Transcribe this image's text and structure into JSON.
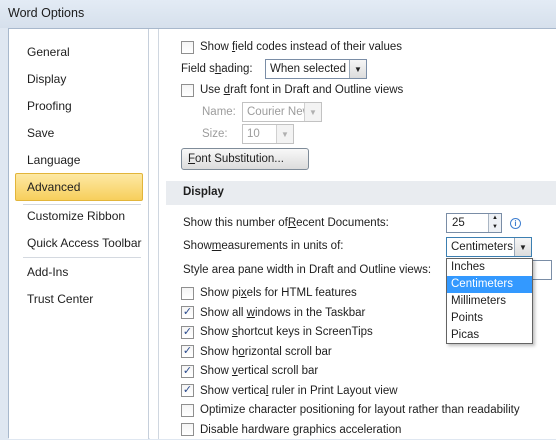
{
  "window": {
    "title": "Word Options"
  },
  "sidebar": {
    "items": [
      {
        "label": "General"
      },
      {
        "label": "Display"
      },
      {
        "label": "Proofing"
      },
      {
        "label": "Save"
      },
      {
        "label": "Language"
      },
      {
        "label": "Advanced",
        "active": true
      },
      {
        "label": "Customize Ribbon"
      },
      {
        "label": "Quick Access Toolbar"
      },
      {
        "label": "Add-Ins"
      },
      {
        "label": "Trust Center"
      }
    ]
  },
  "show_doc": {
    "field_codes": {
      "label_pre": "Show ",
      "key": "f",
      "label_post": "ield codes instead of their values",
      "checked": false
    },
    "field_shading": {
      "label_pre": "Field s",
      "key": "h",
      "label_post": "ading:",
      "value": "When selected"
    },
    "draft_font": {
      "label_pre": "Use ",
      "key": "d",
      "label_post": "raft font in Draft and Outline views",
      "checked": false
    },
    "name": {
      "label": "Name:",
      "value": "Courier New"
    },
    "size": {
      "label": "Size:",
      "value": "10"
    },
    "font_sub_button": {
      "key": "F",
      "label_post": "ont Substitution..."
    }
  },
  "display": {
    "header": "Display",
    "recent_docs": {
      "label_pre": "Show this number of ",
      "key": "R",
      "label_post": "ecent Documents:",
      "value": "25"
    },
    "units": {
      "label_pre": "Show ",
      "key": "m",
      "label_post": "easurements in units of:",
      "value": "Centimeters"
    },
    "style_area": {
      "label": "Style area pane width in Draft and Outline views:"
    },
    "units_options": [
      "Inches",
      "Centimeters",
      "Millimeters",
      "Points",
      "Picas"
    ],
    "units_selected": "Centimeters",
    "checkboxes": [
      {
        "pre": "Show pi",
        "key": "x",
        "post": "els for HTML features",
        "checked": false
      },
      {
        "pre": "Show all ",
        "key": "w",
        "post": "indows in the Taskbar",
        "checked": true
      },
      {
        "pre": "Show ",
        "key": "s",
        "post": "hortcut keys in ScreenTips",
        "checked": true
      },
      {
        "pre": "Show h",
        "key": "o",
        "post": "rizontal scroll bar",
        "checked": true
      },
      {
        "pre": "Show ",
        "key": "v",
        "post": "ertical scroll bar",
        "checked": true
      },
      {
        "pre": "Show vertica",
        "key": "l",
        "post": " ruler in Print Layout view",
        "checked": true
      },
      {
        "pre": "Optimize character positioning for layout rather than readability",
        "key": "",
        "post": "",
        "checked": false
      },
      {
        "pre": "Disable hardware ",
        "key": "g",
        "post": "raphics acceleration",
        "checked": false
      }
    ]
  },
  "colors": {
    "active_nav": "#f7cf5c",
    "selected_option": "#3399ff"
  }
}
